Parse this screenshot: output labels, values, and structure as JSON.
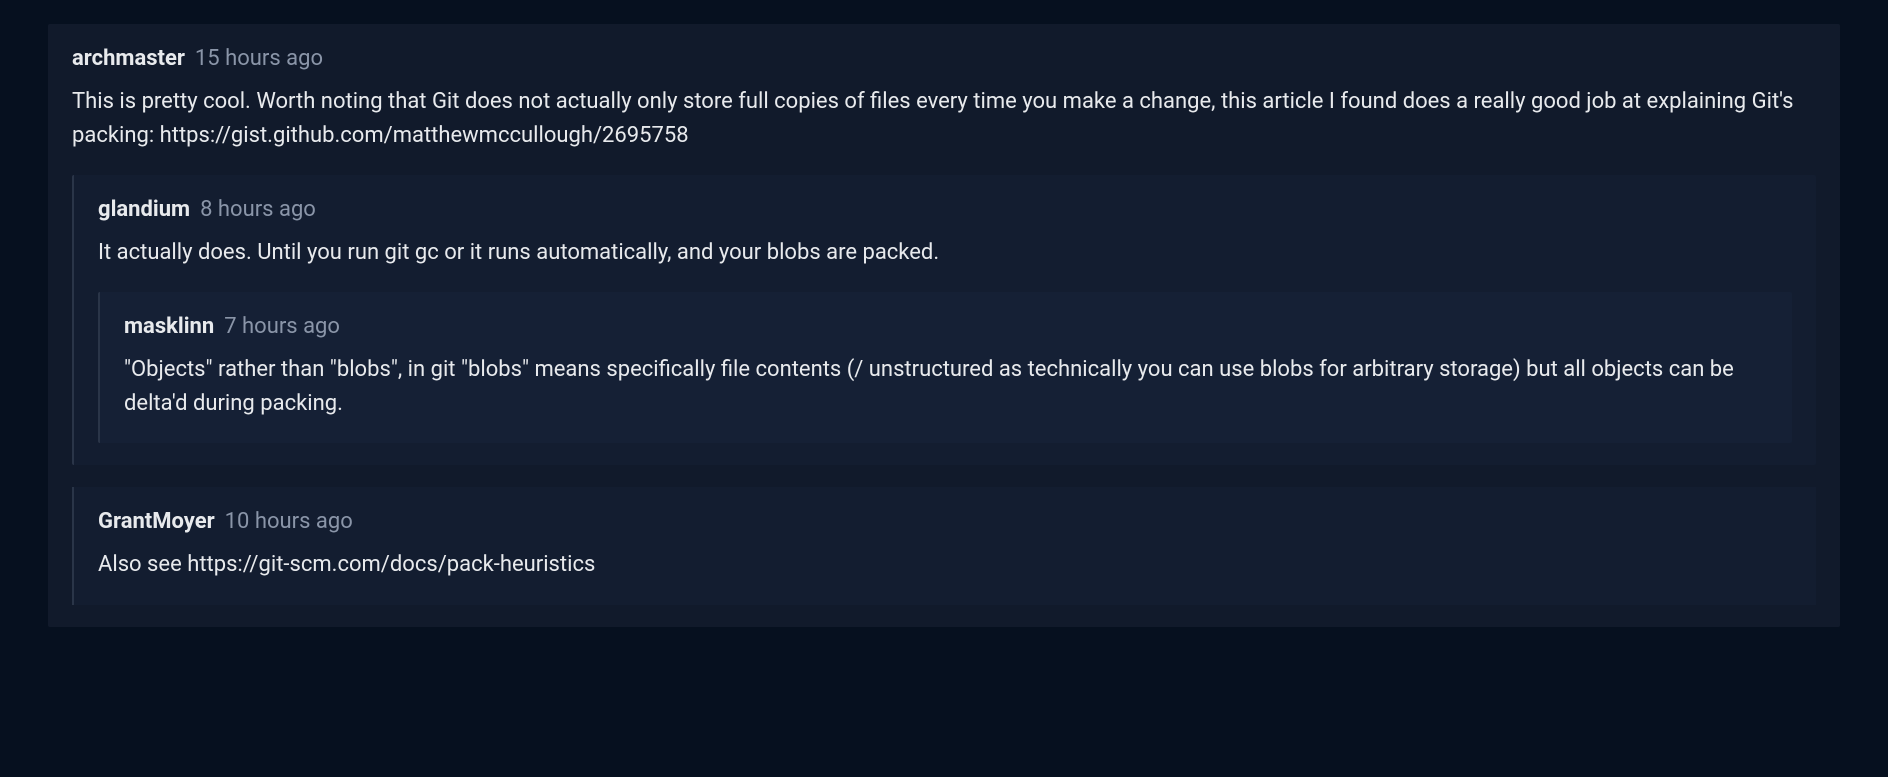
{
  "comments": [
    {
      "username": "archmaster",
      "timestamp": "15 hours ago",
      "body_prefix": "This is pretty cool. Worth noting that Git does not actually only store full copies of files every time you make a change, this article I found does a really good job at explaining Git's packing: ",
      "link_text": "https://gist.github.com/matthewmccullough/2695758",
      "body_suffix": "",
      "level": 0,
      "children": [
        {
          "username": "glandium",
          "timestamp": "8 hours ago",
          "body_prefix": "It actually does. Until you run git gc or it runs automatically, and your blobs are packed.",
          "link_text": "",
          "body_suffix": "",
          "level": 1,
          "children": [
            {
              "username": "masklinn",
              "timestamp": "7 hours ago",
              "body_prefix": "\"Objects\" rather than \"blobs\", in git \"blobs\" means specifically file contents (/ unstructured as technically you can use blobs for arbitrary storage) but all objects can be delta'd during packing.",
              "link_text": "",
              "body_suffix": "",
              "level": 2,
              "children": []
            }
          ]
        },
        {
          "username": "GrantMoyer",
          "timestamp": "10 hours ago",
          "body_prefix": "Also see ",
          "link_text": "https://git-scm.com/docs/pack-heuristics",
          "body_suffix": "",
          "level": 1,
          "children": []
        }
      ]
    }
  ]
}
